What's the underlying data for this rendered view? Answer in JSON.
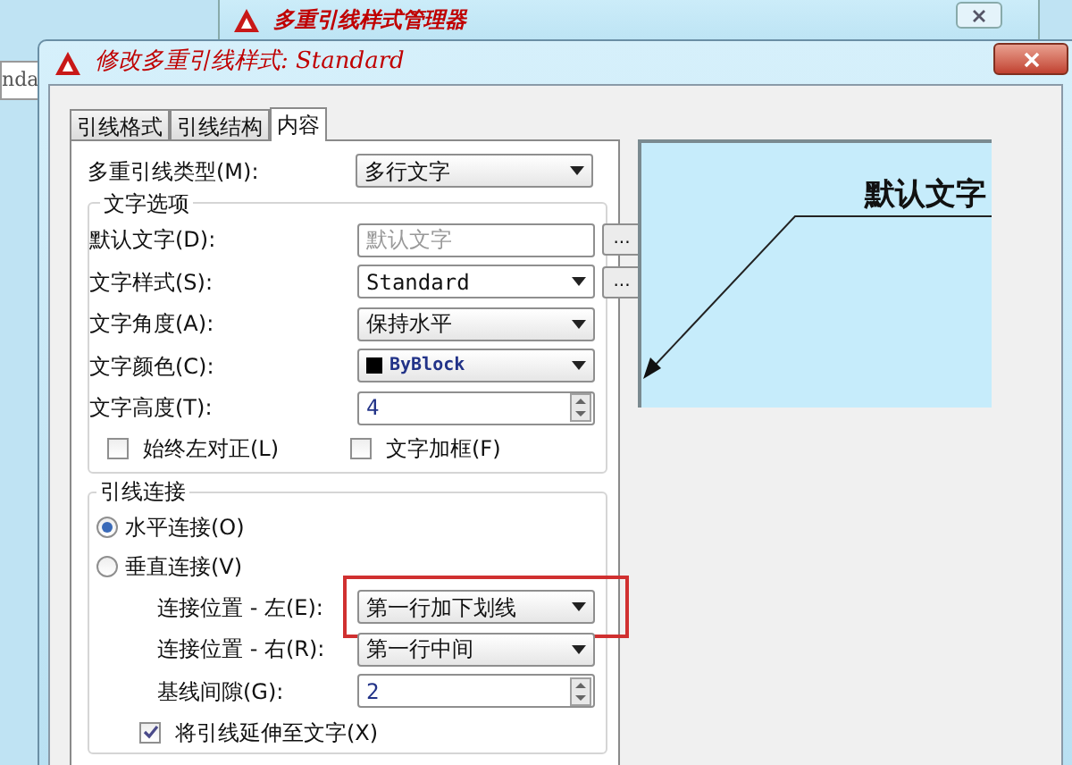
{
  "background_window": {
    "title": "多重引线样式管理器"
  },
  "left_fragment": {
    "text": "nda"
  },
  "dialog": {
    "title": "修改多重引线样式: Standard"
  },
  "tabs": [
    {
      "label": "引线格式",
      "selected": false
    },
    {
      "label": "引线结构",
      "selected": false
    },
    {
      "label": "内容",
      "selected": true
    }
  ],
  "leader_type": {
    "kind": "select",
    "label": "多重引线类型(M):",
    "value": "多行文字"
  },
  "text_options": {
    "title": "文字选项",
    "rows": [
      {
        "kind": "browse-text",
        "label": "默认文字(D):",
        "value": "默认文字",
        "button": "..."
      },
      {
        "kind": "browse-select",
        "label": "文字样式(S):",
        "value": "Standard",
        "button": "..."
      },
      {
        "kind": "select",
        "label": "文字角度(A):",
        "value": "保持水平"
      },
      {
        "kind": "color",
        "label": "文字颜色(C):",
        "value": "ByBlock",
        "color": "#000000"
      },
      {
        "kind": "spinner",
        "label": "文字高度(T):",
        "value": "4"
      }
    ],
    "checkboxes": [
      {
        "label": "始终左对正(L)",
        "checked": false
      },
      {
        "label": "文字加框(F)",
        "checked": false
      }
    ]
  },
  "leader_connection": {
    "title": "引线连接",
    "radios": [
      {
        "label": "水平连接(O)",
        "selected": true
      },
      {
        "label": "垂直连接(V)",
        "selected": false
      }
    ],
    "rows": [
      {
        "kind": "select",
        "label": "连接位置 - 左(E):",
        "value": "第一行加下划线",
        "highlighted": true
      },
      {
        "kind": "select",
        "label": "连接位置 - 右(R):",
        "value": "第一行中间",
        "highlighted": false
      },
      {
        "kind": "spinner",
        "label": "基线间隙(G):",
        "value": "2",
        "highlighted": false
      }
    ],
    "extend": {
      "label": "将引线延伸至文字(X)",
      "checked": true
    }
  },
  "preview": {
    "text": "默认文字"
  }
}
